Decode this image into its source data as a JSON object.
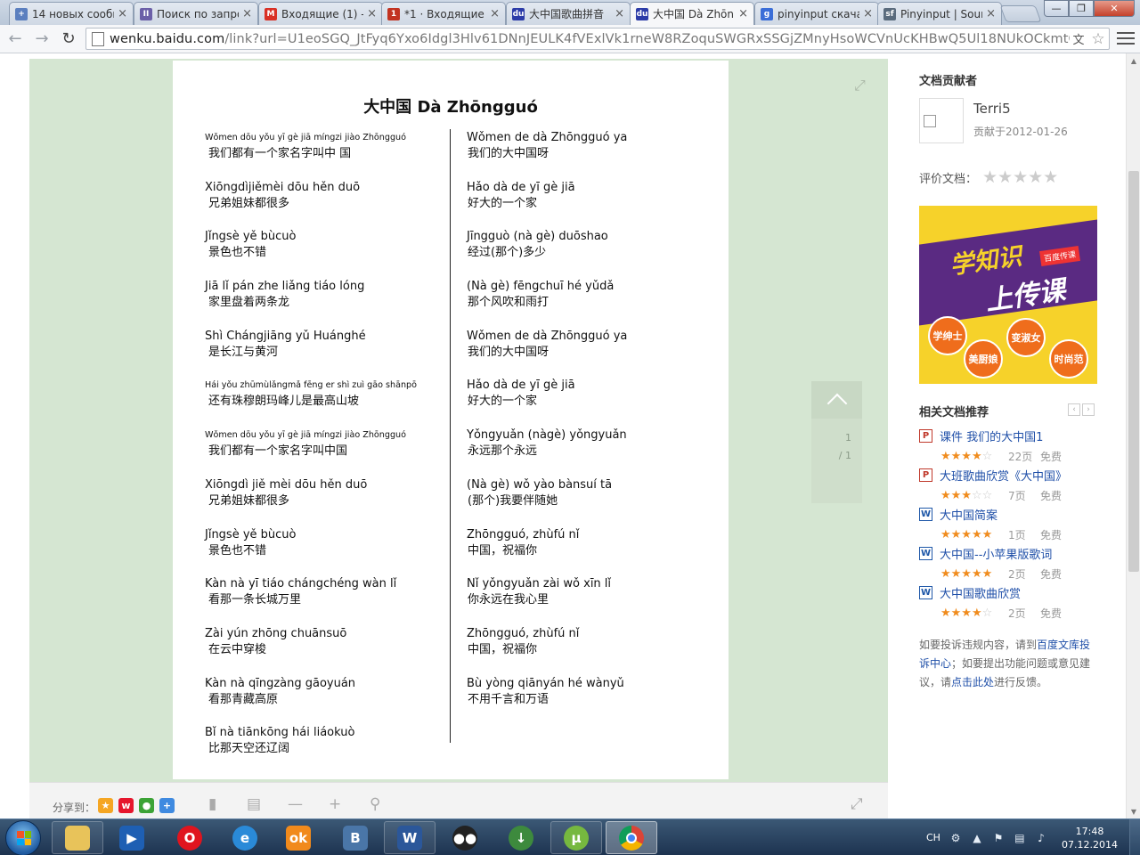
{
  "browser": {
    "tabs": [
      {
        "title": "14 новых сообщ",
        "fav": "+",
        "favcolor": "#5b7fbf"
      },
      {
        "title": "Поиск по запро",
        "fav": "II",
        "favcolor": "#6b5fa8"
      },
      {
        "title": "Входящие (1) -",
        "fav": "M",
        "favcolor": "#d93025"
      },
      {
        "title": "*1 · Входящие",
        "fav": "1",
        "favcolor": "#c23321"
      },
      {
        "title": "大中国歌曲拼音",
        "fav": "du",
        "favcolor": "#2c3ca8"
      },
      {
        "title": "大中国 Dà Zhōn",
        "fav": "du",
        "favcolor": "#2c3ca8"
      },
      {
        "title": "pinyinput скача",
        "fav": "g",
        "favcolor": "#3b6ed8"
      },
      {
        "title": "Pinyinput | Sour",
        "fav": "sf",
        "favcolor": "#5a6b7d"
      }
    ],
    "url_domain": "wenku.baidu.com",
    "url_path": "/link?url=U1eoSGQ_JtFyq6Yxo6Idgl3Hlv61DNnJEULK4fVExlVk1rneW8RZoquSWGRxSSGjZMnyHsoWCVnUcKHBwQ5Ul18NUkOCkmtQ6m"
  },
  "document": {
    "title": "大中国 Dà Zhōngguó",
    "left_column": [
      {
        "pinyin": "Wǒmen dōu yǒu yī gè jiā míngzi jiào Zhōngguó",
        "hanzi": "我们都有一个家名字叫中 国",
        "small": true
      },
      {
        "pinyin": "Xiōngdìjiěmèi dōu hěn duō",
        "hanzi": "兄弟姐妹都很多",
        "small": false
      },
      {
        "pinyin": "Jǐngsè yě bùcuò",
        "hanzi": "景色也不错",
        "small": false
      },
      {
        "pinyin": "Jiā lǐ pán zhe liǎng tiáo lóng",
        "hanzi": "家里盘着两条龙",
        "small": false
      },
      {
        "pinyin": "Shì Chángjiāng yǔ Huánghé",
        "hanzi": "是长江与黄河",
        "small": false
      },
      {
        "pinyin": "Hái yǒu zhūmùlǎngmǎ fēng er shì zuì gāo shānpō",
        "hanzi": "还有珠穆朗玛峰儿是最高山坡",
        "small": true
      },
      {
        "pinyin": "Wǒmen dōu yǒu yī gè jiā míngzi jiào Zhōngguó",
        "hanzi": "我们都有一个家名字叫中国",
        "small": true
      },
      {
        "pinyin": "Xiōngdì jiě mèi dōu hěn duō",
        "hanzi": "兄弟姐妹都很多",
        "small": false
      },
      {
        "pinyin": "Jǐngsè yě bùcuò",
        "hanzi": "景色也不错",
        "small": false
      },
      {
        "pinyin": "Kàn nà yī tiáo chángchéng wàn lǐ",
        "hanzi": "看那一条长城万里",
        "small": false
      },
      {
        "pinyin": "Zài yún zhōng chuānsuō",
        "hanzi": "在云中穿梭",
        "small": false
      },
      {
        "pinyin": "Kàn nà qīngzàng gāoyuán",
        "hanzi": "看那青藏高原",
        "small": false
      },
      {
        "pinyin": "Bǐ nà tiānkōng hái liáokuò",
        "hanzi": "比那天空还辽阔",
        "small": false
      }
    ],
    "right_column": [
      {
        "pinyin": "Wǒmen de dà Zhōngguó ya",
        "hanzi": "我们的大中国呀"
      },
      {
        "pinyin": "Hǎo dà de yī gè jiā",
        "hanzi": "好大的一个家"
      },
      {
        "pinyin": "Jīngguò (nà  gè) duōshao",
        "hanzi": "经过(那个)多少"
      },
      {
        "pinyin": "(Nà gè) fēngchuī hé yǔdǎ",
        "hanzi": "那个风吹和雨打"
      },
      {
        "pinyin": "Wǒmen de dà Zhōngguó ya",
        "hanzi": "我们的大中国呀"
      },
      {
        "pinyin": "Hǎo dà de yī gè jiā",
        "hanzi": "好大的一个家"
      },
      {
        "pinyin": "Yǒngyuǎn (nàgè) yǒngyuǎn",
        "hanzi": "永远那个永远"
      },
      {
        "pinyin": "(Nà gè) wǒ yào bànsuí tā",
        "hanzi": "(那个)我要伴随她"
      },
      {
        "pinyin": "Zhōngguó, zhùfú nǐ",
        "hanzi": "中国，祝福你"
      },
      {
        "pinyin": "Nǐ yǒngyuǎn zài wǒ xīn lǐ",
        "hanzi": "你永远在我心里"
      },
      {
        "pinyin": "Zhōngguó, zhùfú nǐ",
        "hanzi": "中国，祝福你"
      },
      {
        "pinyin": "Bù yòng qiānyán hé wànyǔ",
        "hanzi": "不用千言和万语"
      }
    ],
    "page_current": "1",
    "page_total": "/ 1"
  },
  "reader_bar": {
    "share_label": "分享到："
  },
  "sidebar": {
    "contributor_title": "文档贡献者",
    "contributor_name": "Terri5",
    "contributor_date": "贡献于2012-01-26",
    "rate_label": "评价文档：",
    "ad": {
      "line1": "学知识",
      "line2": "上传课",
      "badge": "百度传课",
      "bubbles": [
        "学绅士",
        "美厨娘",
        "变淑女",
        "时尚范"
      ]
    },
    "related_title": "相关文档推荐",
    "related": [
      {
        "type": "P",
        "name": "课件 我们的大中国1",
        "stars": 4,
        "pages": "22页",
        "price": "免费"
      },
      {
        "type": "P",
        "name": "大班歌曲欣赏《大中国》",
        "stars": 3,
        "pages": "7页",
        "price": "免费"
      },
      {
        "type": "W",
        "name": "大中国简案",
        "stars": 4.5,
        "pages": "1页",
        "price": "免费"
      },
      {
        "type": "W",
        "name": "大中国--小苹果版歌词",
        "stars": 4.5,
        "pages": "2页",
        "price": "免费"
      },
      {
        "type": "W",
        "name": "大中国歌曲欣赏",
        "stars": 4,
        "pages": "2页",
        "price": "免费"
      }
    ],
    "notice": {
      "part1": "如要投诉违规内容，请到",
      "link1": "百度文库投诉中心",
      "part2": "；如要提出功能问题或意见建议，请",
      "link2": "点击此处",
      "part3": "进行反馈。"
    }
  },
  "taskbar": {
    "apps": [
      "explorer",
      "media-player",
      "opera",
      "internet-explorer",
      "odnoklassniki",
      "vk",
      "word",
      "unknown-app",
      "download-manager",
      "utorrent",
      "chrome"
    ],
    "lang": "CH",
    "time": "17:48",
    "date": "07.12.2014"
  }
}
